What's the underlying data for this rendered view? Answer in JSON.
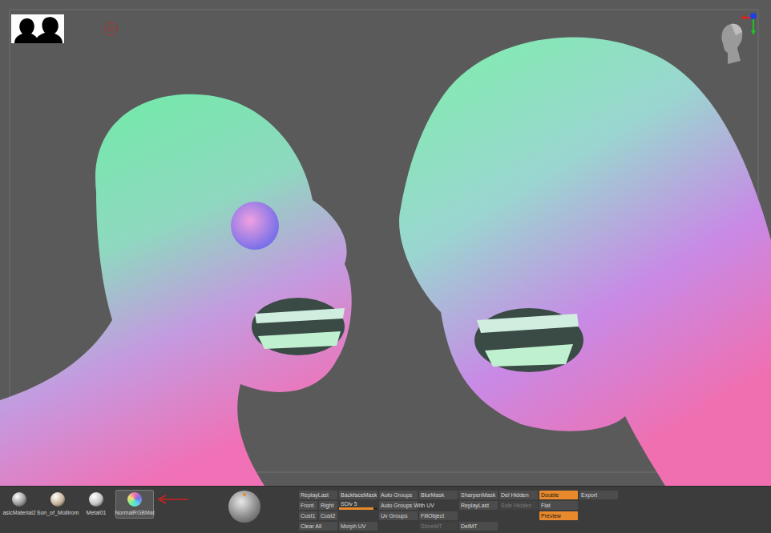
{
  "materials": [
    {
      "label": "asicMaterial2",
      "selected": false,
      "kind": "plain",
      "color": "#9a9a9a"
    },
    {
      "label": "Son_of_Mollirom",
      "selected": false,
      "kind": "plain",
      "color": "#c9b49a"
    },
    {
      "label": "Metal01",
      "selected": false,
      "kind": "plain",
      "color": "#c4c4c4"
    },
    {
      "label": "NormalRGBMat",
      "selected": true,
      "kind": "rgb"
    }
  ],
  "button_columns": [
    [
      [
        {
          "label": "ReplayLast",
          "kind": "button",
          "on": false,
          "disabled": false
        }
      ],
      [
        {
          "label": "Front",
          "kind": "button",
          "on": false,
          "disabled": false
        },
        {
          "label": "Right",
          "kind": "button",
          "on": false,
          "disabled": false
        }
      ],
      [
        {
          "label": "Cust1",
          "kind": "button",
          "on": false,
          "disabled": false
        },
        {
          "label": "Cust2",
          "kind": "button",
          "on": false,
          "disabled": false
        }
      ],
      [
        {
          "label": "Clear All",
          "kind": "button",
          "on": false,
          "disabled": false
        }
      ]
    ],
    [
      [
        {
          "label": "BackfaceMask",
          "kind": "button",
          "on": false,
          "disabled": false
        }
      ],
      [
        {
          "label": "SDiv 5",
          "kind": "slider",
          "level": 0.9
        }
      ],
      [],
      [
        {
          "label": "Morph UV",
          "kind": "button",
          "on": false,
          "disabled": false
        }
      ]
    ],
    [
      [
        {
          "label": "Auto Groups",
          "kind": "button",
          "on": false,
          "disabled": false
        }
      ],
      [
        {
          "label": "Auto Groups With UV",
          "kind": "button",
          "on": false,
          "disabled": false
        }
      ],
      [
        {
          "label": "Uv Groups",
          "kind": "button",
          "on": false,
          "disabled": false
        }
      ],
      []
    ],
    [
      [
        {
          "label": "BlurMask",
          "kind": "button",
          "on": false,
          "disabled": false
        }
      ],
      [],
      [
        {
          "label": "FillObject",
          "kind": "button",
          "on": false,
          "disabled": false
        }
      ],
      [
        {
          "label": "StoreMT",
          "kind": "button",
          "on": false,
          "disabled": true
        }
      ]
    ],
    [
      [
        {
          "label": "SharpenMask",
          "kind": "button",
          "on": false,
          "disabled": false
        }
      ],
      [
        {
          "label": "ReplayLast",
          "kind": "button",
          "on": false,
          "disabled": false
        }
      ],
      [],
      [
        {
          "label": "DelMT",
          "kind": "button",
          "on": false,
          "disabled": false
        }
      ]
    ],
    [
      [
        {
          "label": "Del Hidden",
          "kind": "button",
          "on": false,
          "disabled": false
        }
      ],
      [
        {
          "label": "Sole Hidden",
          "kind": "button",
          "on": false,
          "disabled": true
        }
      ],
      [],
      []
    ],
    [
      [
        {
          "label": "Double",
          "kind": "button",
          "on": true,
          "disabled": false
        }
      ],
      [
        {
          "label": "Flat",
          "kind": "button",
          "on": false,
          "disabled": false
        }
      ],
      [
        {
          "label": "Preview",
          "kind": "button",
          "on": true,
          "disabled": false
        }
      ],
      []
    ],
    [
      [
        {
          "label": "Export",
          "kind": "button",
          "on": false,
          "disabled": false
        }
      ],
      [],
      [],
      []
    ]
  ]
}
